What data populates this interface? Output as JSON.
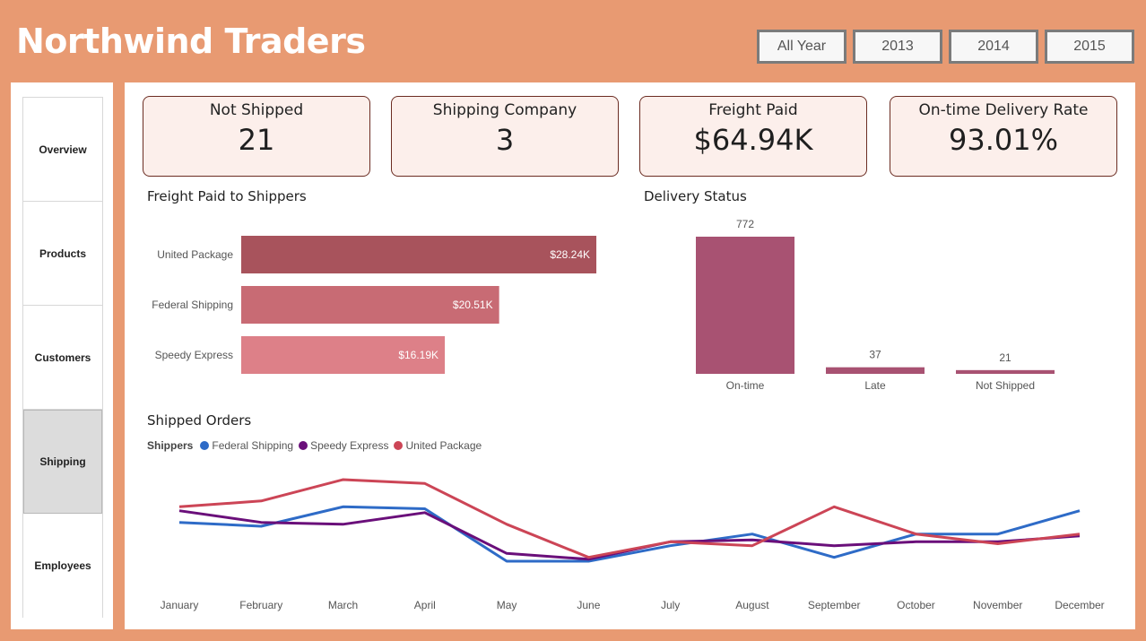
{
  "header": {
    "title": "Northwind Traders"
  },
  "year_filter": [
    "All Year",
    "2013",
    "2014",
    "2015"
  ],
  "sidebar": {
    "items": [
      "Overview",
      "Products",
      "Customers",
      "Shipping",
      "Employees"
    ],
    "active": "Shipping"
  },
  "kpis": [
    {
      "label": "Not Shipped",
      "value": "21"
    },
    {
      "label": "Shipping Company",
      "value": "3"
    },
    {
      "label": "Freight Paid",
      "value": "$64.94K"
    },
    {
      "label": "On-time Delivery Rate",
      "value": "93.01%"
    }
  ],
  "chart_data": [
    {
      "type": "bar",
      "orientation": "horizontal",
      "title": "Freight Paid to Shippers",
      "categories": [
        "United Package",
        "Federal Shipping",
        "Speedy Express"
      ],
      "values": [
        28240,
        20510,
        16190
      ],
      "data_labels": [
        "$28.24K",
        "$20.51K",
        "$16.19K"
      ],
      "colors": [
        "#a8535c",
        "#c86b74",
        "#dd8088"
      ]
    },
    {
      "type": "bar",
      "title": "Delivery Status",
      "categories": [
        "On-time",
        "Late",
        "Not Shipped"
      ],
      "values": [
        772,
        37,
        21
      ],
      "data_labels": [
        "772",
        "37",
        "21"
      ],
      "color": "#a85272"
    },
    {
      "type": "line",
      "title": "Shipped Orders",
      "legend_title": "Shippers",
      "x": [
        "January",
        "February",
        "March",
        "April",
        "May",
        "June",
        "July",
        "August",
        "September",
        "October",
        "November",
        "December"
      ],
      "series": [
        {
          "name": "Federal Shipping",
          "color": "#2e6bc7",
          "values": [
            26,
            25,
            30,
            29.5,
            16,
            16,
            20,
            23,
            17,
            23,
            23,
            29
          ]
        },
        {
          "name": "Speedy Express",
          "color": "#6a0f7a",
          "values": [
            29,
            26,
            25.5,
            28.5,
            18,
            16.5,
            21,
            21.5,
            20,
            21,
            21,
            22.5
          ]
        },
        {
          "name": "United Package",
          "color": "#cc4556",
          "values": [
            30,
            31.5,
            37,
            36,
            25.5,
            17,
            21,
            20,
            30,
            23,
            20.5,
            23
          ]
        }
      ],
      "ylim": [
        10,
        40
      ]
    }
  ]
}
